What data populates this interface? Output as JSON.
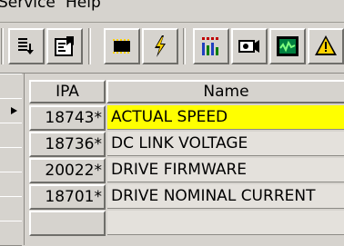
{
  "menu": {
    "service_label": "Service",
    "help_label": "Help"
  },
  "toolbar": {
    "buttons": [
      {
        "icon": "download-list-icon"
      },
      {
        "icon": "properties-icon"
      },
      {
        "icon": "chip-icon"
      },
      {
        "icon": "lightning-icon"
      },
      {
        "icon": "bar-trend-icon"
      },
      {
        "icon": "camera-icon"
      },
      {
        "icon": "oscilloscope-icon"
      },
      {
        "icon": "warning-icon"
      }
    ]
  },
  "table": {
    "columns": {
      "ipa": "IPA",
      "name": "Name"
    },
    "rows": [
      {
        "ipa": "18743*",
        "name": "ACTUAL SPEED",
        "selected": true
      },
      {
        "ipa": "18736*",
        "name": "DC LINK VOLTAGE",
        "selected": false
      },
      {
        "ipa": "20022*",
        "name": "DRIVE FIRMWARE",
        "selected": false
      },
      {
        "ipa": "18701*",
        "name": "DRIVE NOMINAL CURRENT",
        "selected": false
      }
    ]
  },
  "colors": {
    "selected_row": "#ffff00",
    "window_bg": "#d6d3ce"
  }
}
